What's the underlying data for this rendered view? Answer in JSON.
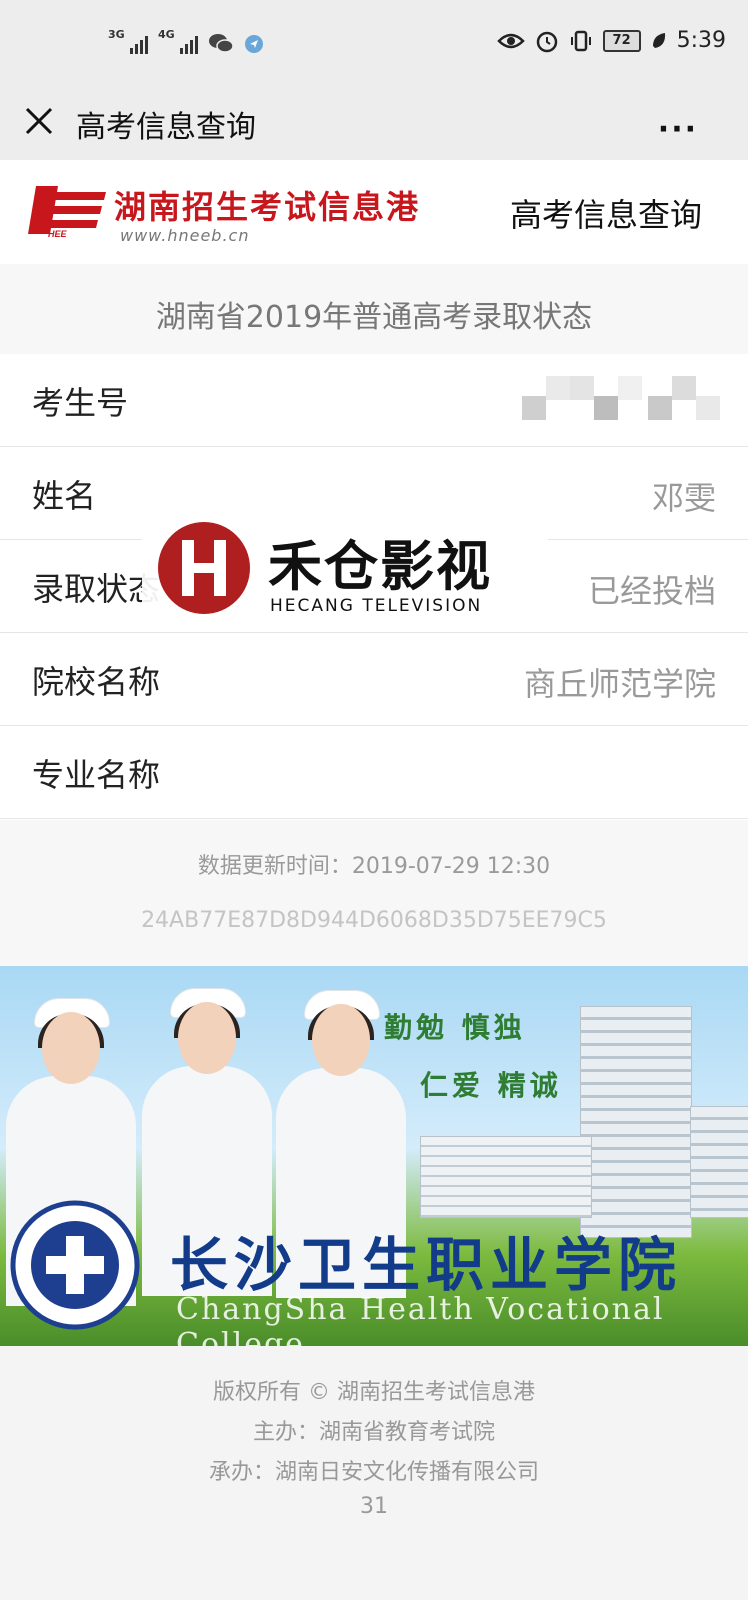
{
  "status_bar": {
    "net1": "3G",
    "net2": "4G",
    "battery": "72",
    "time": "5:39"
  },
  "titlebar": {
    "title": "高考信息查询",
    "more": "···"
  },
  "header": {
    "logo_text": "HEE",
    "site_name": "湖南招生考试信息港",
    "site_url": "www.hneeb.cn",
    "right_title": "高考信息查询"
  },
  "subheader": "湖南省2019年普通高考录取状态",
  "rows": [
    {
      "label": "考生号",
      "value": ""
    },
    {
      "label": "姓名",
      "value": "邓雯"
    },
    {
      "label": "录取状态",
      "value": "已经投档"
    },
    {
      "label": "院校名称",
      "value": "商丘师范学院"
    },
    {
      "label": "专业名称",
      "value": ""
    }
  ],
  "meta": {
    "update_time": "数据更新时间：2019-07-29 12:30",
    "hash": "24AB77E87D8D944D6068D35D75EE79C5"
  },
  "watermark": {
    "cn": "禾仓影视",
    "en": "HECANG TELEVISION"
  },
  "banner": {
    "slogan1": "勤勉 慎独",
    "slogan2": "仁爱 精诚",
    "college": "长沙卫生职业学院",
    "college_en": "ChangSha Health Vocational College"
  },
  "footer": {
    "copyright": "版权所有 © 湖南招生考试信息港",
    "host": "主办：湖南省教育考试院",
    "organizer": "承办：湖南日安文化传播有限公司",
    "page": "31"
  },
  "colors": {
    "brand_red": "#c8161d",
    "bar_bg": "#ededed",
    "muted": "#999999"
  }
}
